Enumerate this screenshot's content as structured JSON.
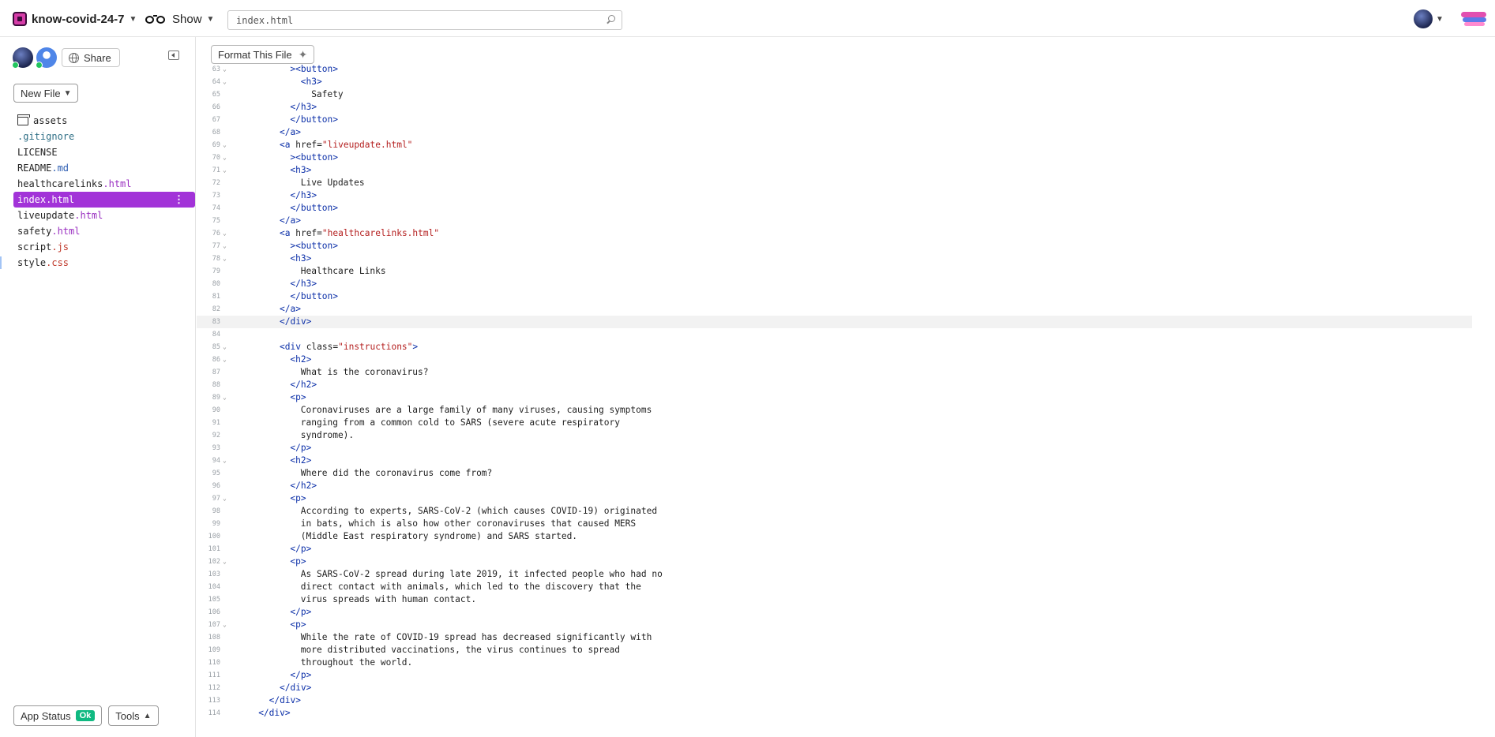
{
  "topbar": {
    "project_name": "know-covid-24-7",
    "show_label": "Show",
    "search_value": "index.html"
  },
  "sidebar": {
    "share_label": "Share",
    "new_file_label": "New File",
    "files": [
      {
        "name": "assets",
        "ext": "",
        "type": "folder"
      },
      {
        "name": ".gitignore",
        "ext": "",
        "type": "git"
      },
      {
        "name": "LICENSE",
        "ext": "",
        "type": "file"
      },
      {
        "name": "README",
        "ext": ".md",
        "type": "md"
      },
      {
        "name": "healthcarelinks",
        "ext": ".html",
        "type": "html"
      },
      {
        "name": "index.html",
        "ext": "",
        "type": "active"
      },
      {
        "name": "liveupdate",
        "ext": ".html",
        "type": "html"
      },
      {
        "name": "safety",
        "ext": ".html",
        "type": "html"
      },
      {
        "name": "script",
        "ext": ".js",
        "type": "js"
      },
      {
        "name": "style",
        "ext": ".css",
        "type": "css"
      }
    ],
    "app_status_label": "App Status",
    "app_status_badge": "Ok",
    "tools_label": "Tools"
  },
  "editor": {
    "format_label": "Format This File",
    "highlight_line": 83,
    "lines": [
      {
        "n": 63,
        "fold": true,
        "ind": 6,
        "seg": [
          [
            "tag",
            "><button>"
          ]
        ]
      },
      {
        "n": 64,
        "fold": true,
        "ind": 7,
        "seg": [
          [
            "tag",
            "<h3>"
          ]
        ]
      },
      {
        "n": 65,
        "fold": false,
        "ind": 8,
        "seg": [
          [
            "txt",
            "Safety"
          ]
        ]
      },
      {
        "n": 66,
        "fold": false,
        "ind": 6,
        "seg": [
          [
            "tag",
            "</h3>"
          ]
        ]
      },
      {
        "n": 67,
        "fold": false,
        "ind": 6,
        "seg": [
          [
            "tag",
            "</button>"
          ]
        ]
      },
      {
        "n": 68,
        "fold": false,
        "ind": 5,
        "seg": [
          [
            "tag",
            "</a>"
          ]
        ]
      },
      {
        "n": 69,
        "fold": true,
        "ind": 5,
        "seg": [
          [
            "tag",
            "<a "
          ],
          [
            "attr",
            "href="
          ],
          [
            "str",
            "\"liveupdate.html\""
          ]
        ]
      },
      {
        "n": 70,
        "fold": true,
        "ind": 6,
        "seg": [
          [
            "tag",
            "><button>"
          ]
        ]
      },
      {
        "n": 71,
        "fold": true,
        "ind": 6,
        "seg": [
          [
            "tag",
            "<h3>"
          ]
        ]
      },
      {
        "n": 72,
        "fold": false,
        "ind": 7,
        "seg": [
          [
            "txt",
            "Live Updates"
          ]
        ]
      },
      {
        "n": 73,
        "fold": false,
        "ind": 6,
        "seg": [
          [
            "tag",
            "</h3>"
          ]
        ]
      },
      {
        "n": 74,
        "fold": false,
        "ind": 6,
        "seg": [
          [
            "tag",
            "</button>"
          ]
        ]
      },
      {
        "n": 75,
        "fold": false,
        "ind": 5,
        "seg": [
          [
            "tag",
            "</a>"
          ]
        ]
      },
      {
        "n": 76,
        "fold": true,
        "ind": 5,
        "seg": [
          [
            "tag",
            "<a "
          ],
          [
            "attr",
            "href="
          ],
          [
            "str",
            "\"healthcarelinks.html\""
          ]
        ]
      },
      {
        "n": 77,
        "fold": true,
        "ind": 6,
        "seg": [
          [
            "tag",
            "><button>"
          ]
        ]
      },
      {
        "n": 78,
        "fold": true,
        "ind": 6,
        "seg": [
          [
            "tag",
            "<h3>"
          ]
        ]
      },
      {
        "n": 79,
        "fold": false,
        "ind": 7,
        "seg": [
          [
            "txt",
            "Healthcare Links"
          ]
        ]
      },
      {
        "n": 80,
        "fold": false,
        "ind": 6,
        "seg": [
          [
            "tag",
            "</h3>"
          ]
        ]
      },
      {
        "n": 81,
        "fold": false,
        "ind": 6,
        "seg": [
          [
            "tag",
            "</button>"
          ]
        ]
      },
      {
        "n": 82,
        "fold": false,
        "ind": 5,
        "seg": [
          [
            "tag",
            "</a>"
          ]
        ]
      },
      {
        "n": 83,
        "fold": false,
        "ind": 5,
        "seg": [
          [
            "tag",
            "</div>"
          ]
        ]
      },
      {
        "n": 84,
        "fold": false,
        "ind": 0,
        "seg": []
      },
      {
        "n": 85,
        "fold": true,
        "ind": 5,
        "seg": [
          [
            "tag",
            "<div "
          ],
          [
            "attr",
            "class="
          ],
          [
            "str",
            "\"instructions\""
          ],
          [
            "tag",
            ">"
          ]
        ]
      },
      {
        "n": 86,
        "fold": true,
        "ind": 6,
        "seg": [
          [
            "tag",
            "<h2>"
          ]
        ]
      },
      {
        "n": 87,
        "fold": false,
        "ind": 7,
        "seg": [
          [
            "txt",
            "What is the coronavirus?"
          ]
        ]
      },
      {
        "n": 88,
        "fold": false,
        "ind": 6,
        "seg": [
          [
            "tag",
            "</h2>"
          ]
        ]
      },
      {
        "n": 89,
        "fold": true,
        "ind": 6,
        "seg": [
          [
            "tag",
            "<p>"
          ]
        ]
      },
      {
        "n": 90,
        "fold": false,
        "ind": 7,
        "seg": [
          [
            "txt",
            "Coronaviruses are a large family of many viruses, causing symptoms"
          ]
        ]
      },
      {
        "n": 91,
        "fold": false,
        "ind": 7,
        "seg": [
          [
            "txt",
            "ranging from a common cold to SARS (severe acute respiratory"
          ]
        ]
      },
      {
        "n": 92,
        "fold": false,
        "ind": 7,
        "seg": [
          [
            "txt",
            "syndrome)."
          ]
        ]
      },
      {
        "n": 93,
        "fold": false,
        "ind": 6,
        "seg": [
          [
            "tag",
            "</p>"
          ]
        ]
      },
      {
        "n": 94,
        "fold": true,
        "ind": 6,
        "seg": [
          [
            "tag",
            "<h2>"
          ]
        ]
      },
      {
        "n": 95,
        "fold": false,
        "ind": 7,
        "seg": [
          [
            "txt",
            "Where did the coronavirus come from?"
          ]
        ]
      },
      {
        "n": 96,
        "fold": false,
        "ind": 6,
        "seg": [
          [
            "tag",
            "</h2>"
          ]
        ]
      },
      {
        "n": 97,
        "fold": true,
        "ind": 6,
        "seg": [
          [
            "tag",
            "<p>"
          ]
        ]
      },
      {
        "n": 98,
        "fold": false,
        "ind": 7,
        "seg": [
          [
            "txt",
            "According to experts, SARS-CoV-2 (which causes COVID-19) originated"
          ]
        ]
      },
      {
        "n": 99,
        "fold": false,
        "ind": 7,
        "seg": [
          [
            "txt",
            "in bats, which is also how other coronaviruses that caused MERS"
          ]
        ]
      },
      {
        "n": 100,
        "fold": false,
        "ind": 7,
        "seg": [
          [
            "txt",
            "(Middle East respiratory syndrome) and SARS started."
          ]
        ]
      },
      {
        "n": 101,
        "fold": false,
        "ind": 6,
        "seg": [
          [
            "tag",
            "</p>"
          ]
        ]
      },
      {
        "n": 102,
        "fold": true,
        "ind": 6,
        "seg": [
          [
            "tag",
            "<p>"
          ]
        ]
      },
      {
        "n": 103,
        "fold": false,
        "ind": 7,
        "seg": [
          [
            "txt",
            "As SARS-CoV-2 spread during late 2019, it infected people who had no"
          ]
        ]
      },
      {
        "n": 104,
        "fold": false,
        "ind": 7,
        "seg": [
          [
            "txt",
            "direct contact with animals, which led to the discovery that the"
          ]
        ]
      },
      {
        "n": 105,
        "fold": false,
        "ind": 7,
        "seg": [
          [
            "txt",
            "virus spreads with human contact."
          ]
        ]
      },
      {
        "n": 106,
        "fold": false,
        "ind": 6,
        "seg": [
          [
            "tag",
            "</p>"
          ]
        ]
      },
      {
        "n": 107,
        "fold": true,
        "ind": 6,
        "seg": [
          [
            "tag",
            "<p>"
          ]
        ]
      },
      {
        "n": 108,
        "fold": false,
        "ind": 7,
        "seg": [
          [
            "txt",
            "While the rate of COVID-19 spread has decreased significantly with"
          ]
        ]
      },
      {
        "n": 109,
        "fold": false,
        "ind": 7,
        "seg": [
          [
            "txt",
            "more distributed vaccinations, the virus continues to spread"
          ]
        ]
      },
      {
        "n": 110,
        "fold": false,
        "ind": 7,
        "seg": [
          [
            "txt",
            "throughout the world."
          ]
        ]
      },
      {
        "n": 111,
        "fold": false,
        "ind": 6,
        "seg": [
          [
            "tag",
            "</p>"
          ]
        ]
      },
      {
        "n": 112,
        "fold": false,
        "ind": 5,
        "seg": [
          [
            "tag",
            "</div>"
          ]
        ]
      },
      {
        "n": 113,
        "fold": false,
        "ind": 4,
        "seg": [
          [
            "tag",
            "</div>"
          ]
        ]
      },
      {
        "n": 114,
        "fold": false,
        "ind": 3,
        "seg": [
          [
            "tag",
            "</div>"
          ]
        ]
      }
    ]
  }
}
